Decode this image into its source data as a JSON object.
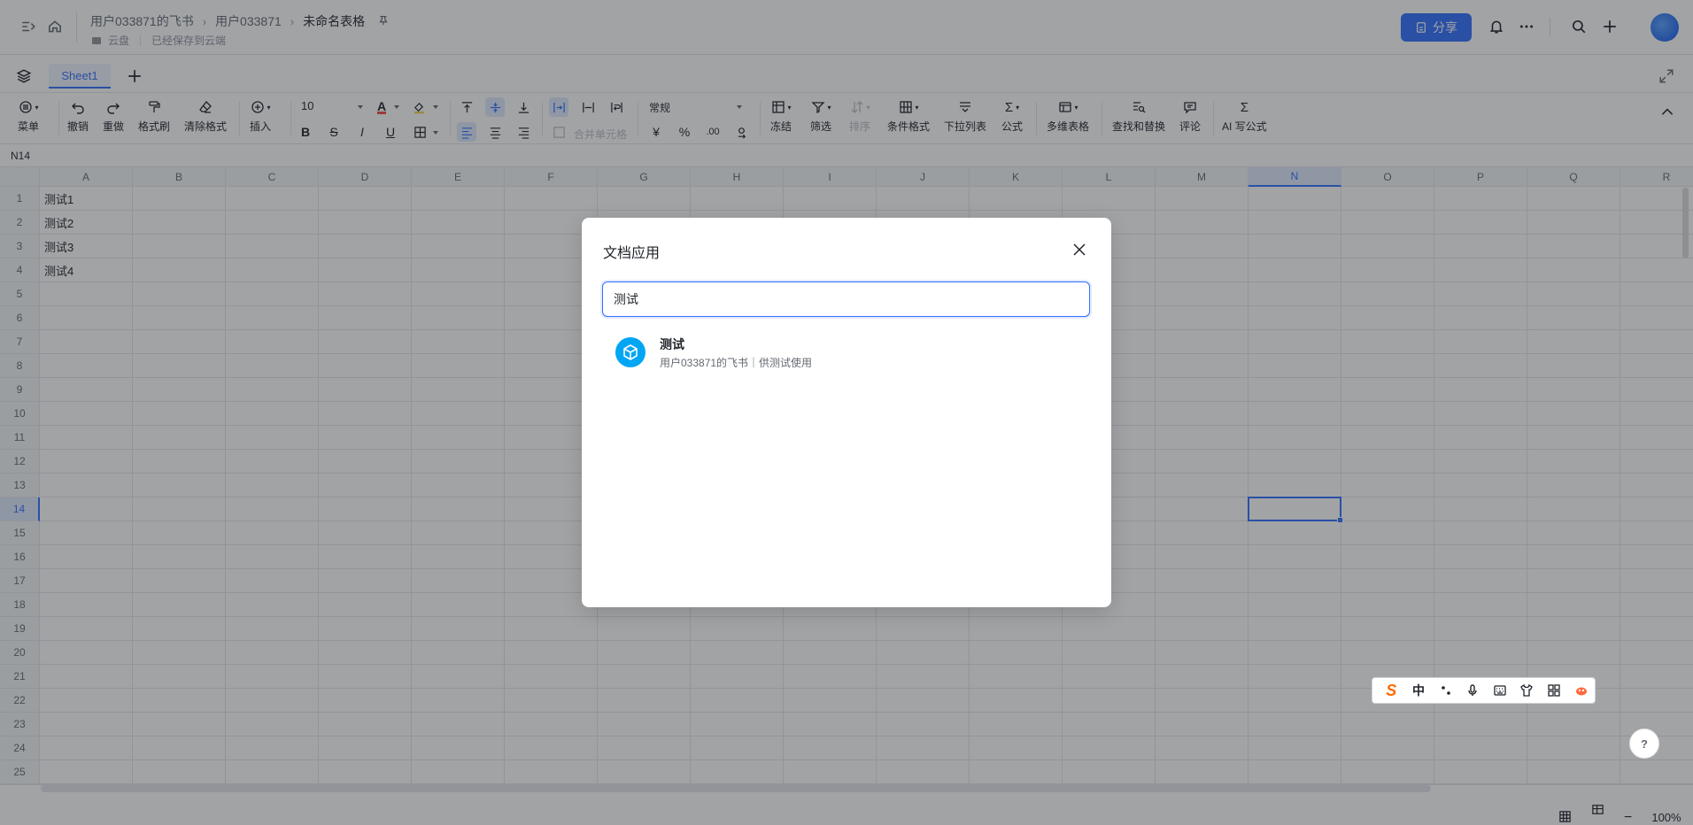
{
  "breadcrumbs": [
    "用户033871的飞书",
    "用户033871",
    "未命名表格"
  ],
  "subline": {
    "location": "云盘",
    "save_status": "已经保存到云端"
  },
  "share_label": "分享",
  "sheet_tab": "Sheet1",
  "toolbar": {
    "menu": "菜单",
    "undo": "撤销",
    "redo": "重做",
    "format_painter": "格式刷",
    "clear_format": "清除格式",
    "insert": "插入",
    "font_size": "10",
    "bold": "B",
    "strike": "S",
    "italic": "I",
    "underline": "U",
    "merge_cells": "合并单元格",
    "number_format": "常规",
    "currency": "¥",
    "percent": "%",
    "decimals_down": ".00",
    "freeze": "冻结",
    "filter": "筛选",
    "sort": "排序",
    "conditional_format": "条件格式",
    "dropdown_list": "下拉列表",
    "formula": "公式",
    "multi_table": "多维表格",
    "find_replace": "查找和替换",
    "comment": "评论",
    "ai_formula": "AI 写公式"
  },
  "cell_ref": "N14",
  "columns": [
    "A",
    "B",
    "C",
    "D",
    "E",
    "F",
    "G",
    "H",
    "I",
    "J",
    "K",
    "L",
    "M",
    "N",
    "O",
    "P",
    "Q",
    "R"
  ],
  "selected_column": "N",
  "rows": [
    "1",
    "2",
    "3",
    "4",
    "5",
    "6",
    "7",
    "8",
    "9",
    "10",
    "11",
    "12",
    "13",
    "14",
    "15",
    "16",
    "17",
    "18",
    "19",
    "20",
    "21",
    "22",
    "23",
    "24",
    "25"
  ],
  "selected_row": "14",
  "cells_colA": [
    "测试1",
    "测试2",
    "测试3",
    "测试4"
  ],
  "zoom": "100%",
  "modal": {
    "title": "文档应用",
    "search_value": "测试",
    "result": {
      "name": "测试",
      "description": "用户033871的飞书｜供测试使用"
    }
  },
  "ime": {
    "mode": "中"
  },
  "help": "?",
  "colors": {
    "accent": "#3370ff",
    "app_icon": "#00a5f4"
  }
}
